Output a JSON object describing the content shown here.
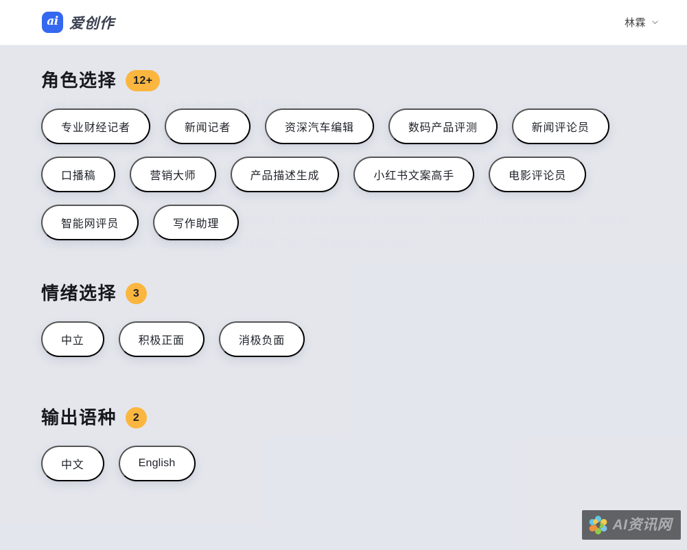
{
  "header": {
    "brand_mark_text": "ai",
    "brand_name": "爱创作",
    "user_name": "林霖",
    "chevron_icon": "chevron-down-icon"
  },
  "background_ghost": {
    "label": "主题",
    "heading": "主播薪资下滑三成，行业走向成熟发展阶段",
    "paragraph_line1": "播薪资的下滑趋势。这一现象引起了不少人的关注。央视名嘴前财经分析师张教授，从过去这几年的直播数据来看，尤其是最",
    "paragraph_line2": "近一段时间，主播的薪资总体来说呈现一定程度的下滑，下滑幅度在 30% 左右。"
  },
  "sections": [
    {
      "title": "角色选择",
      "badge": "12+",
      "badge_shape": "pill",
      "chips": [
        "专业财经记者",
        "新闻记者",
        "资深汽车编辑",
        "数码产品评测",
        "新闻评论员",
        "口播稿",
        "营销大师",
        "产品描述生成",
        "小红书文案高手",
        "电影评论员",
        "智能网评员",
        "写作助理"
      ]
    },
    {
      "title": "情绪选择",
      "badge": "3",
      "badge_shape": "round",
      "chips": [
        "中立",
        "积极正面",
        "消极负面"
      ]
    },
    {
      "title": "输出语种",
      "badge": "2",
      "badge_shape": "round",
      "chips": [
        "中文",
        "English"
      ]
    }
  ],
  "watermark": {
    "text": "AI资讯网",
    "logo_icon": "flower-petals-icon"
  },
  "colors": {
    "page_background": "#e3e6ec",
    "header_background": "#ffffff",
    "brand_blue": "#3468f0",
    "badge_amber": "#fbb63f",
    "chip_white": "#ffffff",
    "text_primary": "#15181d",
    "ghost_text": "#d7dbe3",
    "watermark_background": "#58595b"
  }
}
